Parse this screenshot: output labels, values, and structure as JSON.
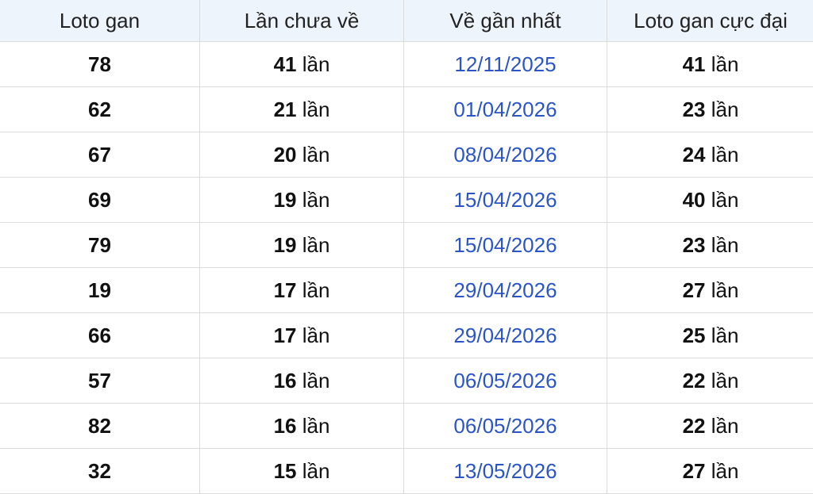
{
  "table": {
    "headers": [
      "Loto gan",
      "Lần chưa về",
      "Về gần nhất",
      "Loto gan cực đại"
    ],
    "unit": "lần",
    "rows": [
      {
        "loto": "78",
        "missed": "41",
        "last_date": "12/11/2025",
        "max_gan": "41"
      },
      {
        "loto": "62",
        "missed": "21",
        "last_date": "01/04/2026",
        "max_gan": "23"
      },
      {
        "loto": "67",
        "missed": "20",
        "last_date": "08/04/2026",
        "max_gan": "24"
      },
      {
        "loto": "69",
        "missed": "19",
        "last_date": "15/04/2026",
        "max_gan": "40"
      },
      {
        "loto": "79",
        "missed": "19",
        "last_date": "15/04/2026",
        "max_gan": "23"
      },
      {
        "loto": "19",
        "missed": "17",
        "last_date": "29/04/2026",
        "max_gan": "27"
      },
      {
        "loto": "66",
        "missed": "17",
        "last_date": "29/04/2026",
        "max_gan": "25"
      },
      {
        "loto": "57",
        "missed": "16",
        "last_date": "06/05/2026",
        "max_gan": "22"
      },
      {
        "loto": "82",
        "missed": "16",
        "last_date": "06/05/2026",
        "max_gan": "22"
      },
      {
        "loto": "32",
        "missed": "15",
        "last_date": "13/05/2026",
        "max_gan": "27"
      }
    ]
  },
  "colors": {
    "header_bg": "#eef4fb",
    "date_text": "#2b55c6",
    "border": "#dcdcdc"
  }
}
